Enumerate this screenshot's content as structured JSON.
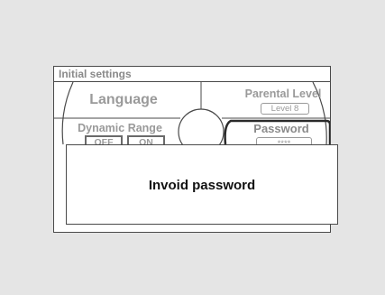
{
  "screen": {
    "title": "Initial settings"
  },
  "menu": {
    "language_label": "Language",
    "parental_level_label": "Parental Level",
    "parental_level_value": "Level 8",
    "dynamic_range_label": "Dynamic Range",
    "dynamic_range_off": "OFF",
    "dynamic_range_on": "ON",
    "password_label": "Password",
    "password_value": "****"
  },
  "dialog": {
    "message": "Invoid password"
  }
}
